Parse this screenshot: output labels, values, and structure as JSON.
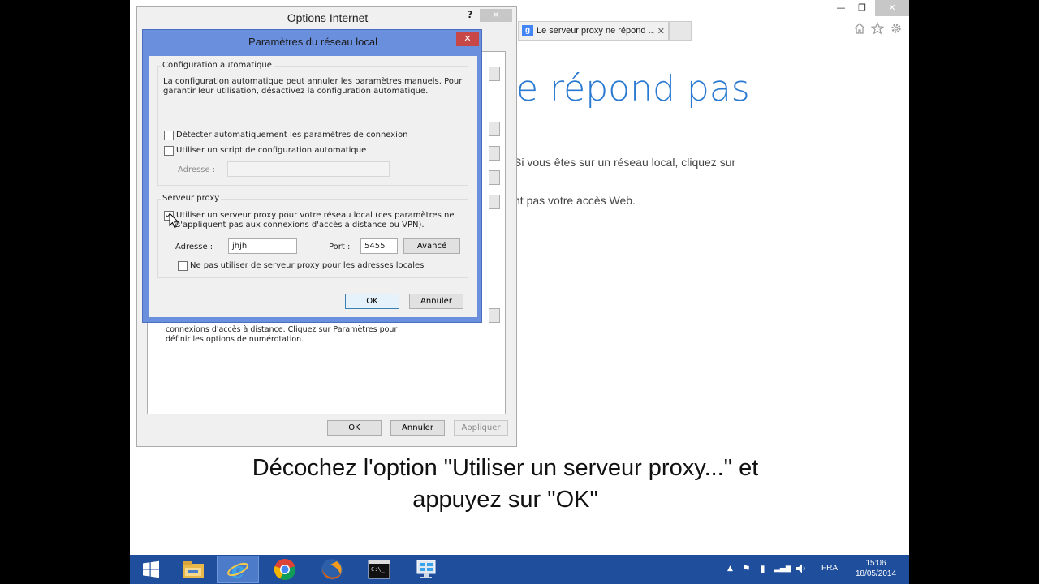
{
  "browser": {
    "tab_title": "Le serveur proxy ne répond ...",
    "tab_favicon": "g",
    "tab_close": "✕",
    "error_title": "e répond pas",
    "error_line1": "Si vous êtes sur un réseau local, cliquez sur",
    "error_line2": "nt pas votre accès Web.",
    "window_controls": {
      "minimize": "—",
      "restore": "❐",
      "close": "✕"
    },
    "toolbar_icons": [
      "home-icon",
      "favorites-star-icon",
      "gear-icon"
    ]
  },
  "options_dialog": {
    "title": "Options Internet",
    "help": "?",
    "close": "✕",
    "lan_text_line1": "connexions d'accès à distance. Cliquez sur Paramètres pour",
    "lan_text_line2": "définir les options de numérotation.",
    "ok": "OK",
    "cancel": "Annuler",
    "apply": "Appliquer"
  },
  "lan_dialog": {
    "title": "Paramètres du réseau local",
    "close": "✕",
    "auto_config": {
      "label": "Configuration automatique",
      "description_line1": "La configuration automatique peut annuler les paramètres manuels. Pour",
      "description_line2": "garantir leur utilisation, désactivez la configuration automatique.",
      "detect_label": "Détecter automatiquement les paramètres de connexion",
      "detect_checked": false,
      "script_label": "Utiliser un script de configuration automatique",
      "script_checked": false,
      "address_label": "Adresse :",
      "address_value": ""
    },
    "proxy": {
      "label": "Serveur proxy",
      "use_proxy_line1": "Utiliser un serveur proxy pour votre réseau local (ces paramètres ne",
      "use_proxy_line2": "s'appliquent pas aux connexions d'accès à distance ou VPN).",
      "use_proxy_checked": true,
      "check_mark": "✓",
      "address_label": "Adresse :",
      "address_value": "jhjh",
      "port_label": "Port :",
      "port_value": "5455",
      "advanced": "Avancé",
      "bypass_label": "Ne pas utiliser de serveur proxy pour les adresses locales",
      "bypass_checked": false
    },
    "ok": "OK",
    "cancel": "Annuler"
  },
  "caption": {
    "line1": "Décochez l'option \"Utiliser un serveur proxy...\" et",
    "line2": "appuyez sur \"OK\""
  },
  "taskbar": {
    "apps": [
      "windows-start-icon",
      "file-explorer-icon",
      "internet-explorer-icon",
      "chrome-icon",
      "firefox-icon",
      "command-prompt-icon",
      "remote-desktop-icon"
    ],
    "active_app": "internet-explorer-icon",
    "tray_language": "FRA",
    "clock_time": "15:06",
    "clock_date": "18/05/2014",
    "tray_icons": {
      "show_hidden": "▲",
      "action_center": "⚑",
      "network": "▂▄▆",
      "volume": "🔊"
    }
  },
  "colors": {
    "taskbar": "#1f4e9c",
    "lan_frame": "#6a8fdd",
    "error_title": "#2a7ad2",
    "close_red": "#c74646"
  }
}
